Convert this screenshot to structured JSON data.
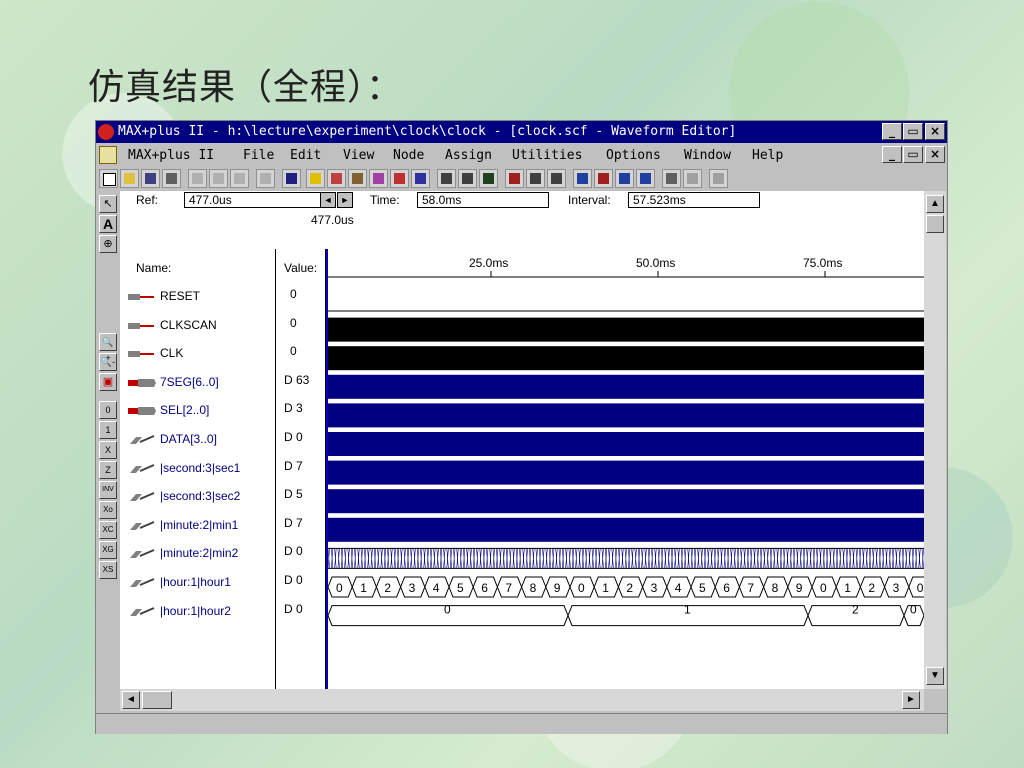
{
  "slide": {
    "title": "仿真结果（全程）："
  },
  "window": {
    "title": "MAX+plus II - h:\\lecture\\experiment\\clock\\clock - [clock.scf - Waveform Editor]",
    "controls": [
      "_",
      "▭",
      "×"
    ]
  },
  "menu": {
    "items": [
      "MAX+plus II",
      "File",
      "Edit",
      "View",
      "Node",
      "Assign",
      "Utilities",
      "Options",
      "Window",
      "Help"
    ]
  },
  "ref": {
    "ref_label": "Ref:",
    "ref_value": "477.0us",
    "time_label": "Time:",
    "time_value": "58.0ms",
    "interval_label": "Interval:",
    "interval_value": "57.523ms",
    "cursor_label": "477.0us"
  },
  "columns": {
    "name": "Name:",
    "value": "Value:"
  },
  "ruler": {
    "ticks": [
      "25.0ms",
      "50.0ms",
      "75.0ms"
    ]
  },
  "signals": [
    {
      "name": "RESET",
      "value": "0",
      "kind": "input"
    },
    {
      "name": "CLKSCAN",
      "value": "0",
      "kind": "input"
    },
    {
      "name": "CLK",
      "value": "0",
      "kind": "input"
    },
    {
      "name": "7SEG[6..0]",
      "value": "D 63",
      "kind": "output-bus"
    },
    {
      "name": "SEL[2..0]",
      "value": "D 3",
      "kind": "output-bus"
    },
    {
      "name": "DATA[3..0]",
      "value": "D 0",
      "kind": "buried"
    },
    {
      "name": "|second:3|sec1",
      "value": "D 7",
      "kind": "buried"
    },
    {
      "name": "|second:3|sec2",
      "value": "D 5",
      "kind": "buried"
    },
    {
      "name": "|minute:2|min1",
      "value": "D 7",
      "kind": "buried"
    },
    {
      "name": "|minute:2|min2",
      "value": "D 0",
      "kind": "buried"
    },
    {
      "name": "|hour:1|hour1",
      "value": "D 0",
      "kind": "buried"
    },
    {
      "name": "|hour:1|hour2",
      "value": "D 0",
      "kind": "buried"
    }
  ],
  "waves": {
    "hour1_labels": [
      "0",
      "1",
      "2",
      "3",
      "4",
      "5",
      "6",
      "7",
      "8",
      "9",
      "0",
      "1",
      "2",
      "3",
      "4",
      "5",
      "6",
      "7",
      "8",
      "9",
      "0",
      "1",
      "2",
      "3",
      "0"
    ],
    "hour2_labels": [
      "0",
      "1",
      "2",
      "0"
    ],
    "colors": {
      "bus": "#000080",
      "solid": "#000000",
      "cursor": "#0000c0"
    }
  },
  "left_tools": [
    "↖",
    "A",
    "⊕",
    "🔍+",
    "🔍-",
    "▣",
    "0",
    "1",
    "X",
    "Z",
    "INV",
    "Xo",
    "XC",
    "XG",
    "XS"
  ]
}
